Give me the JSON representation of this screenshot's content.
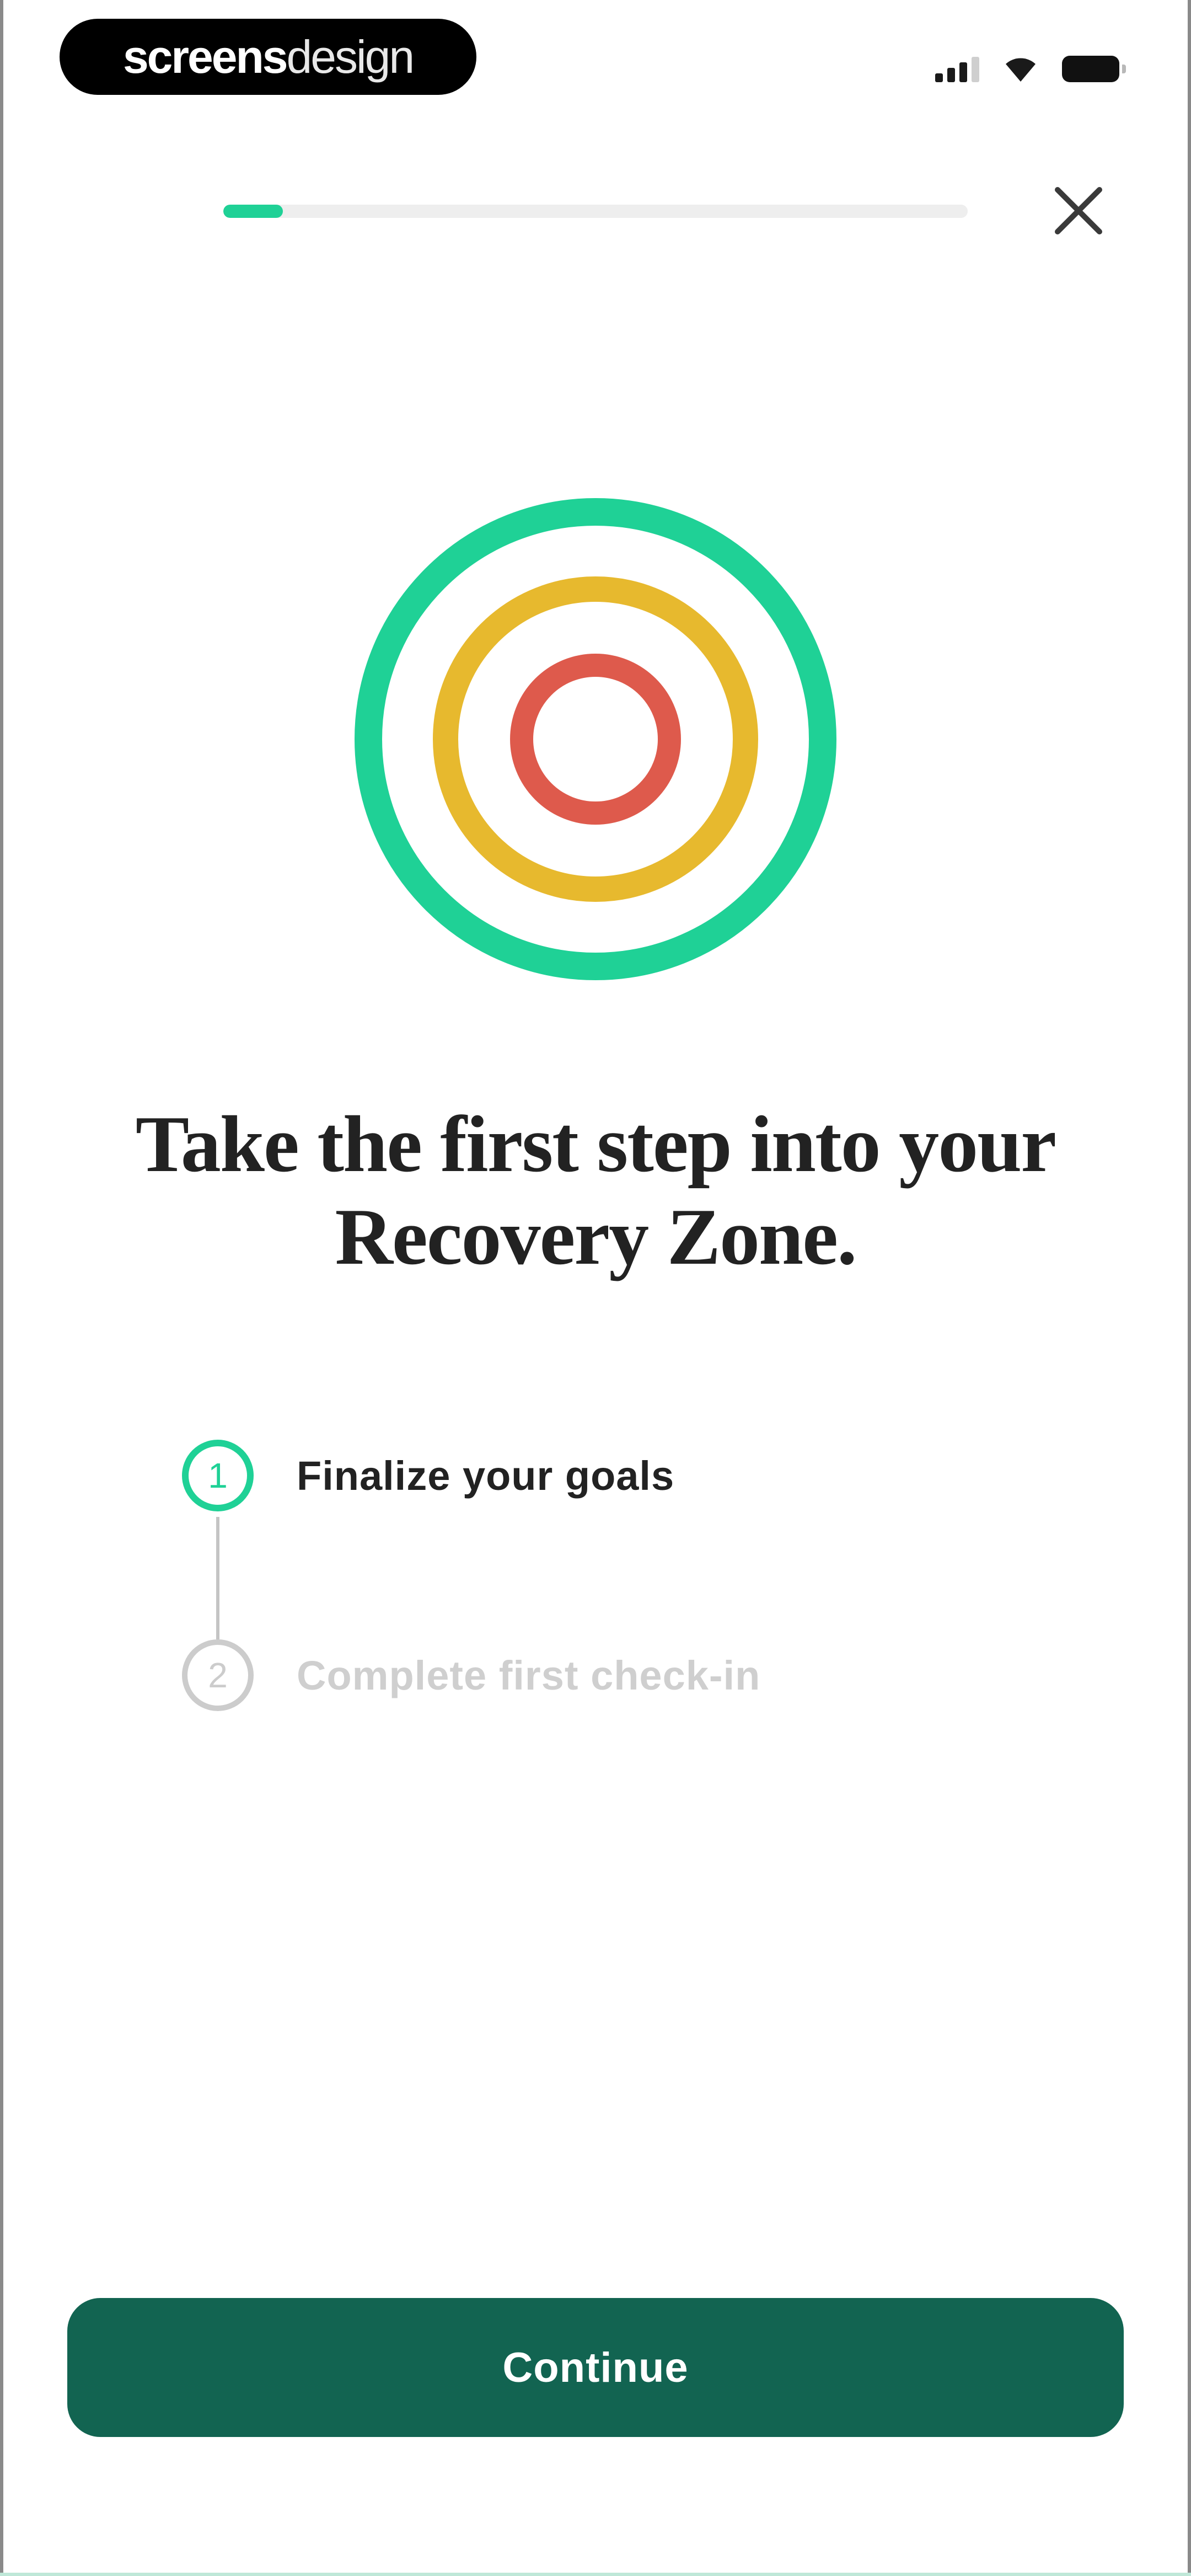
{
  "watermark": {
    "bold_text": "screens",
    "light_text": "design"
  },
  "status_bar": {
    "icons": [
      "cellular-signal-icon",
      "wifi-icon",
      "battery-icon"
    ]
  },
  "onboarding": {
    "progress_fraction": 0.08,
    "close_icon": "close-icon",
    "illustration": "target-icon",
    "headline": "Take the first step into your Recovery Zone.",
    "steps": [
      {
        "number": "1",
        "label": "Finalize your goals",
        "state": "active"
      },
      {
        "number": "2",
        "label": "Complete first check-in",
        "state": "inactive"
      }
    ],
    "continue_label": "Continue"
  },
  "colors": {
    "accent_green": "#1fd196",
    "target_outer": "#1fd196",
    "target_middle": "#e7b92e",
    "target_inner": "#de5a4c",
    "button_bg": "#126451",
    "headline_text": "#222222",
    "inactive_text": "#cfcfcf"
  }
}
